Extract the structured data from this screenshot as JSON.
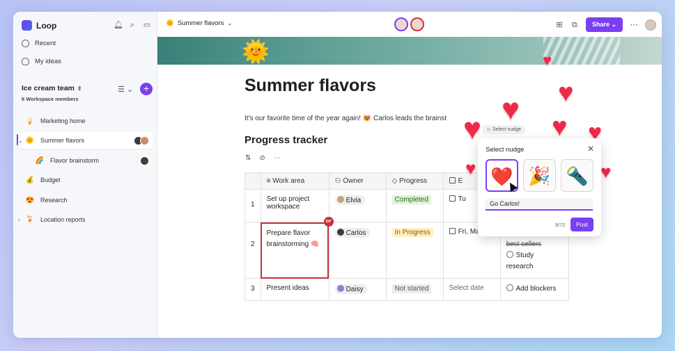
{
  "app": {
    "name": "Loop"
  },
  "sidebar": {
    "recent": "Recent",
    "my_ideas": "My ideas",
    "team_name": "Ice cream team",
    "team_members": "6 Workspace members",
    "items": [
      {
        "label": "Marketing home",
        "emoji": "🍦"
      },
      {
        "label": "Summer flavors",
        "emoji": "🌞"
      },
      {
        "label": "Flavor brainstorm",
        "emoji": "🌈"
      },
      {
        "label": "Budget",
        "emoji": "💰"
      },
      {
        "label": "Research",
        "emoji": "😍"
      },
      {
        "label": "Location reports",
        "emoji": "🍹"
      }
    ]
  },
  "header": {
    "doc_title": "Summer flavors",
    "doc_emoji": "🌞",
    "share_label": "Share"
  },
  "page": {
    "title": "Summer flavors",
    "intro": "It's our favorite time of the year again! 😻 Carlos leads the brainst",
    "tracker_heading": "Progress tracker"
  },
  "table": {
    "headers": [
      "Work area",
      "Owner",
      "Progress",
      "E"
    ],
    "rows": [
      {
        "num": "1",
        "work": "Set up project workspace",
        "owner": "Elvia",
        "progress": "Completed",
        "date": "Tu",
        "extra": ""
      },
      {
        "num": "2",
        "work": "Prepare flavor brainstorming 🧠",
        "owner": "Carlos",
        "progress": "In Progress",
        "date": "Fri, Mar 17",
        "extra1": "Get input for best sellers",
        "extra2": "Study research"
      },
      {
        "num": "3",
        "work": "Present ideas",
        "owner": "Daisy",
        "progress": "Not started",
        "date": "Select date",
        "extra": "Add blockers"
      }
    ],
    "badge": "DP"
  },
  "nudge": {
    "chip": "Select nudge",
    "title": "Select nudge",
    "options": [
      "❤️",
      "🎉",
      "🔦"
    ],
    "input_value": "Go Carlos!",
    "counter": "9/72",
    "post_label": "Post"
  },
  "colors": {
    "accent": "#7b3ff2",
    "heart": "#ee2a49",
    "selection": "#c5303a"
  }
}
